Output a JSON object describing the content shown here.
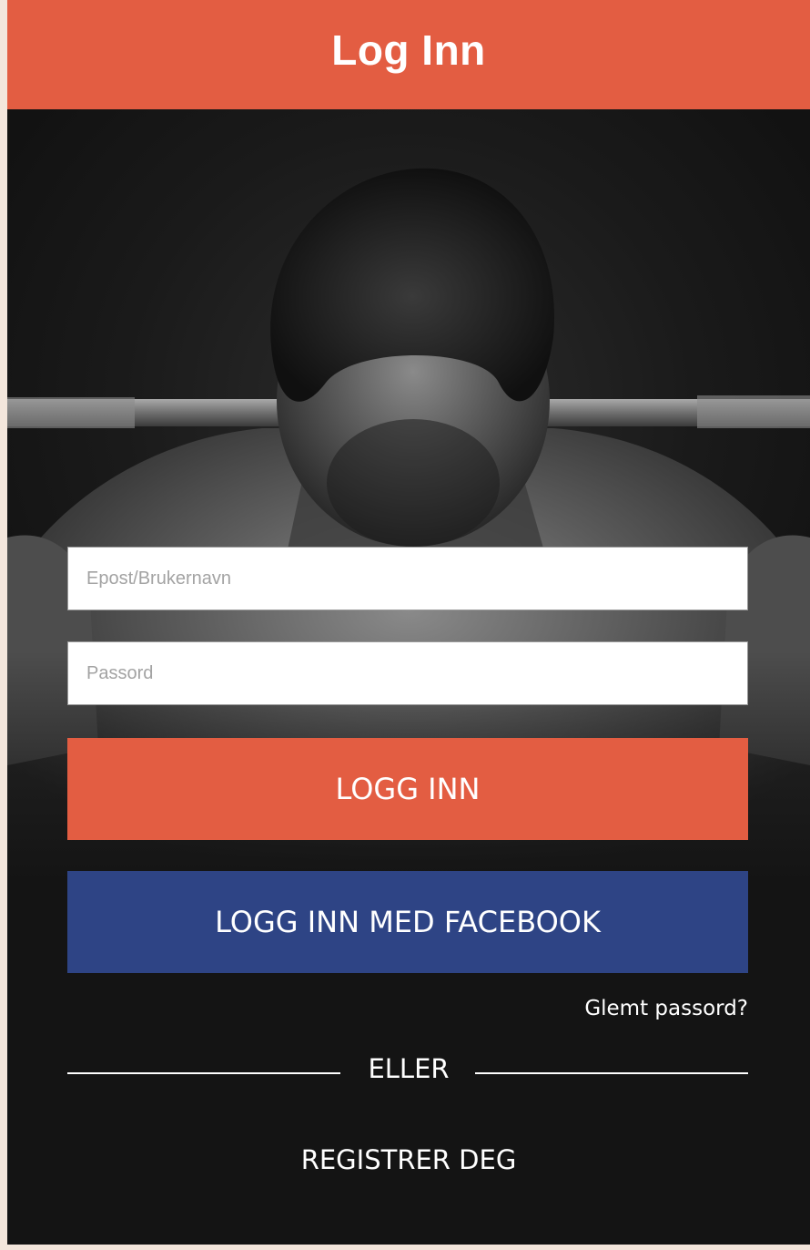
{
  "header": {
    "title": "Log Inn"
  },
  "hero": {
    "icon": "weightlifter-photo"
  },
  "form": {
    "email_placeholder": "Epost/Brukernavn",
    "email_value": "",
    "password_placeholder": "Passord",
    "password_value": "",
    "login_label": "LOGG INN",
    "facebook_label": "LOGG INN MED FACEBOOK",
    "forgot_label": "Glemt passord?",
    "or_label": "ELLER",
    "register_label": "REGISTRER DEG"
  },
  "colors": {
    "accent": "#e35d42",
    "facebook": "#2e4485",
    "background": "#141414"
  }
}
